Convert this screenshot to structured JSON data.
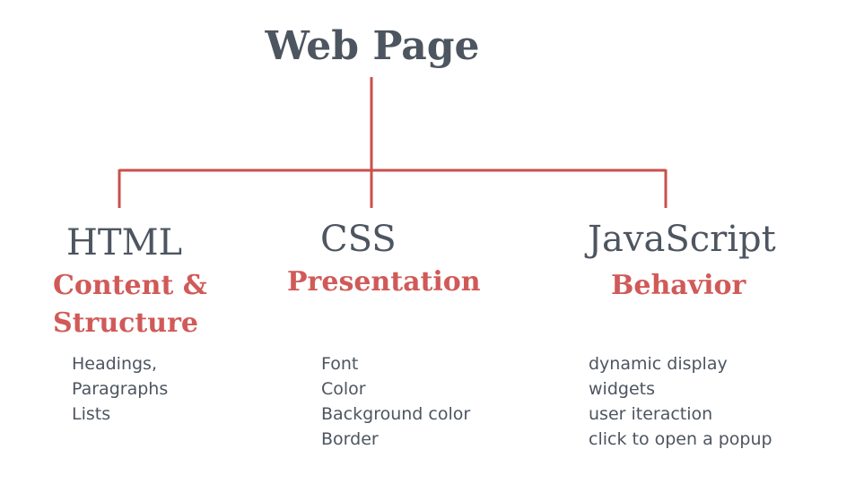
{
  "diagram": {
    "root": "Web Page",
    "line_color": "#c9504c",
    "text_color": "#4d5560",
    "accent_color": "#d05a58",
    "nodes": [
      {
        "title": "HTML",
        "subtitle_lines": [
          "Content &",
          "Structure"
        ],
        "items": [
          "Headings,",
          "Paragraphs",
          "Lists"
        ]
      },
      {
        "title": "CSS",
        "subtitle_lines": [
          "Presentation"
        ],
        "items": [
          "Font",
          "Color",
          "Background color",
          "Border"
        ]
      },
      {
        "title": "JavaScript",
        "subtitle_lines": [
          "Behavior"
        ],
        "items": [
          "dynamic display",
          "widgets",
          "user iteraction",
          "click to open a popup"
        ]
      }
    ]
  }
}
